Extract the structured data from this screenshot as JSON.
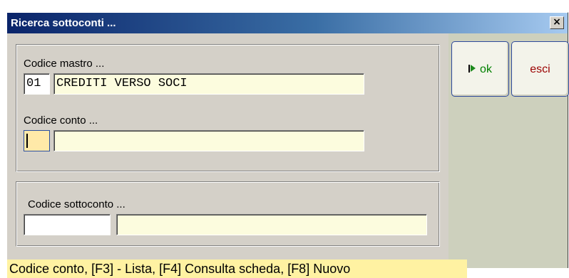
{
  "window": {
    "title": "Ricerca sottoconti ...",
    "close_glyph": "×"
  },
  "mastro": {
    "label": "Codice mastro ...",
    "code": "01",
    "description": "CREDITI VERSO SOCI"
  },
  "conto": {
    "label": "Codice conto ...",
    "code": "",
    "description": ""
  },
  "sottoconto": {
    "label": "Codice sottoconto  ...",
    "code": "",
    "description": ""
  },
  "buttons": {
    "ok_label": "ok",
    "ok_icon": "play-icon",
    "exit_label": "esci"
  },
  "status": {
    "text": "Codice conto,  [F3] - Lista, [F4] Consulta scheda, [F8] Nuovo"
  },
  "colors": {
    "title_gradient_start": "#0a246a",
    "title_gradient_end": "#a6caf0",
    "field_background": "#fcfcde",
    "focused_field": "#ffe9a8",
    "status_background": "#fff2a2",
    "ok_text": "#008000",
    "exit_text": "#9b0000"
  }
}
